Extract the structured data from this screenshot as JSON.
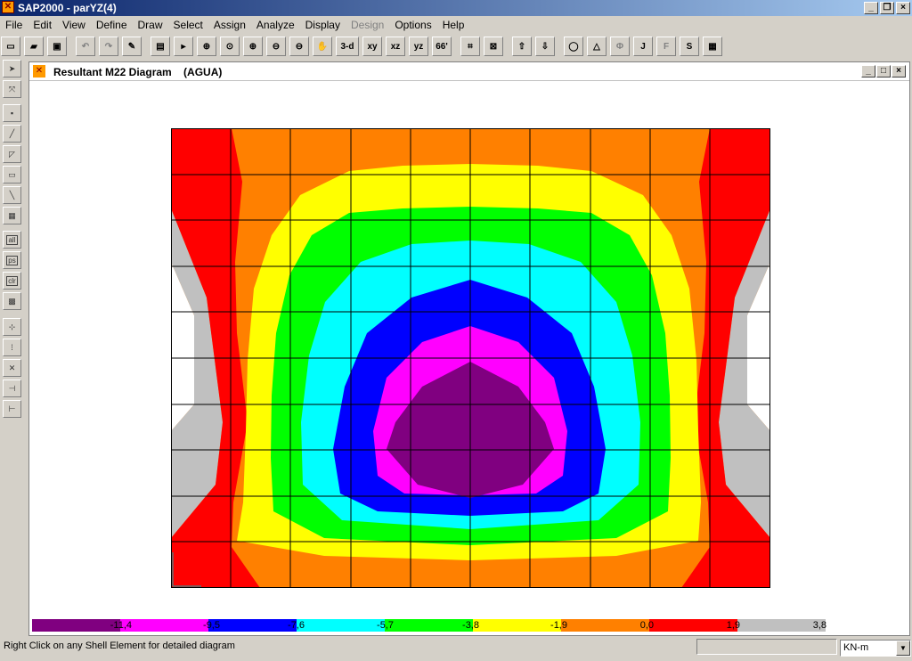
{
  "app": {
    "title": "SAP2000 - parYZ(4)"
  },
  "menu": [
    "File",
    "Edit",
    "View",
    "Define",
    "Draw",
    "Select",
    "Assign",
    "Analyze",
    "Display",
    "Design",
    "Options",
    "Help"
  ],
  "menu_disabled": [
    "Design"
  ],
  "toolbar": [
    "3-d",
    "xy",
    "xz",
    "yz",
    "66'",
    "Φ",
    "J",
    "F",
    "S"
  ],
  "window": {
    "title": "Resultant M22 Diagram",
    "case": "(AGUA)"
  },
  "legend": {
    "labels": [
      "-11,4",
      "-9,5",
      "-7,6",
      "-5,7",
      "-3,8",
      "-1,9",
      "0,0",
      "1,9",
      "3,8"
    ],
    "colors": [
      "#800080",
      "#ff00ff",
      "#0000ff",
      "#00ffff",
      "#00ff00",
      "#ffff00",
      "#ff8000",
      "#ff0000",
      "#c0c0c0"
    ]
  },
  "status": {
    "message": "Right Click on any Shell Element for detailed diagram",
    "units": "KN-m"
  }
}
